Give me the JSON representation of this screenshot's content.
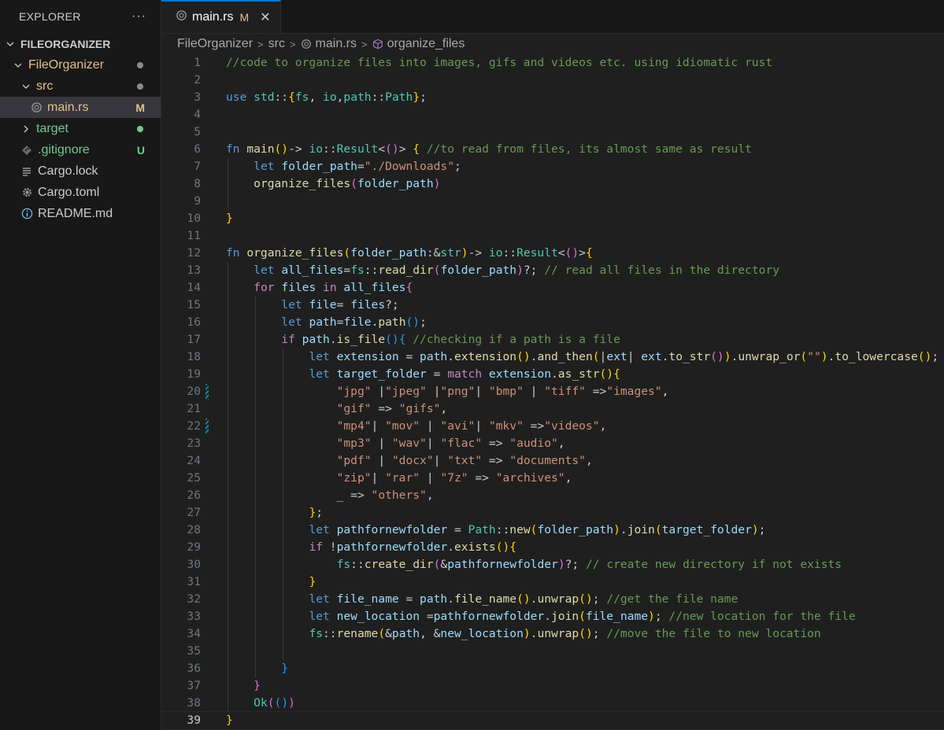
{
  "sidebar": {
    "title": "EXPLORER",
    "more": "···",
    "root": "FILEORGANIZER",
    "items": [
      {
        "label": "FileOrganizer",
        "status": "dot",
        "status_color": "#8b8b8b"
      },
      {
        "label": "src",
        "status": "dot",
        "status_color": "#8b8b8b"
      },
      {
        "label": "main.rs",
        "badge": "M"
      },
      {
        "label": "target",
        "status": "dot",
        "status_color": "#73c991"
      },
      {
        "label": ".gitignore",
        "badge": "U"
      },
      {
        "label": "Cargo.lock"
      },
      {
        "label": "Cargo.toml"
      },
      {
        "label": "README.md"
      }
    ]
  },
  "tab": {
    "label": "main.rs",
    "modified": "M",
    "close": "✕"
  },
  "breadcrumb": [
    "FileOrganizer",
    "src",
    "main.rs",
    "organize_files"
  ],
  "editor": {
    "active_line": 39,
    "lines": [
      [
        [
          "com",
          "//code to organize files into images, gifs and videos etc. using idiomatic rust"
        ]
      ],
      [],
      [
        [
          "kw",
          "use "
        ],
        [
          "ty",
          "std"
        ],
        [
          "",
          "::"
        ],
        [
          "p1",
          "{"
        ],
        [
          "ty",
          "fs"
        ],
        [
          "",
          ", "
        ],
        [
          "ty",
          "io"
        ],
        [
          "",
          ","
        ],
        [
          "ty",
          "path"
        ],
        [
          "",
          "::"
        ],
        [
          "ty",
          "Path"
        ],
        [
          "p1",
          "}"
        ],
        [
          "",
          ";"
        ]
      ],
      [],
      [],
      [
        [
          "kw",
          "fn "
        ],
        [
          "fn",
          "main"
        ],
        [
          "p1",
          "()"
        ],
        [
          "",
          "-> "
        ],
        [
          "ty",
          "io"
        ],
        [
          "",
          "::"
        ],
        [
          "ty",
          "Result"
        ],
        [
          "",
          "<"
        ],
        [
          "p2",
          "()"
        ],
        [
          "",
          "> "
        ],
        [
          "p1",
          "{"
        ],
        [
          "com",
          " //to read from files, its almost same as result"
        ]
      ],
      [
        [
          "",
          "    "
        ],
        [
          "kw",
          "let "
        ],
        [
          "var",
          "folder_path"
        ],
        [
          "",
          "="
        ],
        [
          "str",
          "\"./Downloads\""
        ],
        [
          "",
          ";"
        ]
      ],
      [
        [
          "",
          "    "
        ],
        [
          "fn",
          "organize_files"
        ],
        [
          "p2",
          "("
        ],
        [
          "var",
          "folder_path"
        ],
        [
          "p2",
          ")"
        ]
      ],
      [],
      [
        [
          "p1",
          "}"
        ]
      ],
      [],
      [
        [
          "kw",
          "fn "
        ],
        [
          "fn",
          "organize_files"
        ],
        [
          "p1",
          "("
        ],
        [
          "var",
          "folder_path"
        ],
        [
          "",
          ":&"
        ],
        [
          "ty",
          "str"
        ],
        [
          "p1",
          ")"
        ],
        [
          "",
          "-> "
        ],
        [
          "ty",
          "io"
        ],
        [
          "",
          "::"
        ],
        [
          "ty",
          "Result"
        ],
        [
          "",
          "<"
        ],
        [
          "p2",
          "()"
        ],
        [
          "",
          ">"
        ],
        [
          "p1",
          "{"
        ]
      ],
      [
        [
          "",
          "    "
        ],
        [
          "kw",
          "let "
        ],
        [
          "var",
          "all_files"
        ],
        [
          "",
          "="
        ],
        [
          "ty",
          "fs"
        ],
        [
          "",
          "::"
        ],
        [
          "fn",
          "read_dir"
        ],
        [
          "p2",
          "("
        ],
        [
          "var",
          "folder_path"
        ],
        [
          "p2",
          ")"
        ],
        [
          "",
          "?; "
        ],
        [
          "com",
          "// read all files in the directory"
        ]
      ],
      [
        [
          "",
          "    "
        ],
        [
          "ctrl",
          "for "
        ],
        [
          "var",
          "files "
        ],
        [
          "ctrl",
          "in "
        ],
        [
          "var",
          "all_files"
        ],
        [
          "p2",
          "{"
        ]
      ],
      [
        [
          "",
          "        "
        ],
        [
          "kw",
          "let "
        ],
        [
          "var",
          "file"
        ],
        [
          "",
          "= "
        ],
        [
          "var",
          "files"
        ],
        [
          "",
          "?;"
        ]
      ],
      [
        [
          "",
          "        "
        ],
        [
          "kw",
          "let "
        ],
        [
          "var",
          "path"
        ],
        [
          "",
          "="
        ],
        [
          "var",
          "file"
        ],
        [
          "",
          "."
        ],
        [
          "fn",
          "path"
        ],
        [
          "p3",
          "()"
        ],
        [
          "",
          ";"
        ]
      ],
      [
        [
          "",
          "        "
        ],
        [
          "ctrl",
          "if "
        ],
        [
          "var",
          "path"
        ],
        [
          "",
          "."
        ],
        [
          "fn",
          "is_file"
        ],
        [
          "p3",
          "()"
        ],
        [
          "p3",
          "{"
        ],
        [
          "com",
          " //checking if a path is a file"
        ]
      ],
      [
        [
          "",
          "            "
        ],
        [
          "kw",
          "let "
        ],
        [
          "var",
          "extension"
        ],
        [
          "",
          " = "
        ],
        [
          "var",
          "path"
        ],
        [
          "",
          "."
        ],
        [
          "fn",
          "extension"
        ],
        [
          "p1",
          "()"
        ],
        [
          "",
          "."
        ],
        [
          "fn",
          "and_then"
        ],
        [
          "p1",
          "("
        ],
        [
          "",
          "|"
        ],
        [
          "var",
          "ext"
        ],
        [
          "",
          "| "
        ],
        [
          "var",
          "ext"
        ],
        [
          "",
          "."
        ],
        [
          "fn",
          "to_str"
        ],
        [
          "p2",
          "()"
        ],
        [
          "p1",
          ")"
        ],
        [
          "",
          "."
        ],
        [
          "fn",
          "unwrap_or"
        ],
        [
          "p1",
          "("
        ],
        [
          "str",
          "\"\""
        ],
        [
          "p1",
          ")"
        ],
        [
          "",
          "."
        ],
        [
          "fn",
          "to_lowercase"
        ],
        [
          "p1",
          "()"
        ],
        [
          "",
          ";"
        ]
      ],
      [
        [
          "",
          "            "
        ],
        [
          "kw",
          "let "
        ],
        [
          "var",
          "target_folder"
        ],
        [
          "",
          " = "
        ],
        [
          "ctrl",
          "match "
        ],
        [
          "var",
          "extension"
        ],
        [
          "",
          "."
        ],
        [
          "fn",
          "as_str"
        ],
        [
          "p1",
          "()"
        ],
        [
          "p1",
          "{"
        ]
      ],
      [
        [
          "",
          "                "
        ],
        [
          "str",
          "\"jpg\""
        ],
        [
          "",
          " |"
        ],
        [
          "str",
          "\"jpeg\""
        ],
        [
          "",
          " |"
        ],
        [
          "str",
          "\"png\""
        ],
        [
          "",
          "| "
        ],
        [
          "str",
          "\"bmp\""
        ],
        [
          "",
          " | "
        ],
        [
          "str",
          "\"tiff\""
        ],
        [
          "",
          " =>"
        ],
        [
          "str",
          "\"images\""
        ],
        [
          "",
          ","
        ]
      ],
      [
        [
          "",
          "                "
        ],
        [
          "str",
          "\"gif\""
        ],
        [
          "",
          " => "
        ],
        [
          "str",
          "\"gifs\""
        ],
        [
          "",
          ","
        ]
      ],
      [
        [
          "",
          "                "
        ],
        [
          "str",
          "\"mp4\""
        ],
        [
          "",
          "| "
        ],
        [
          "str",
          "\"mov\""
        ],
        [
          "",
          " | "
        ],
        [
          "str",
          "\"avi\""
        ],
        [
          "",
          "| "
        ],
        [
          "str",
          "\"mkv\""
        ],
        [
          "",
          " =>"
        ],
        [
          "str",
          "\"videos\""
        ],
        [
          "",
          ","
        ]
      ],
      [
        [
          "",
          "                "
        ],
        [
          "str",
          "\"mp3\""
        ],
        [
          "",
          " | "
        ],
        [
          "str",
          "\"wav\""
        ],
        [
          "",
          "| "
        ],
        [
          "str",
          "\"flac\""
        ],
        [
          "",
          " => "
        ],
        [
          "str",
          "\"audio\""
        ],
        [
          "",
          ","
        ]
      ],
      [
        [
          "",
          "                "
        ],
        [
          "str",
          "\"pdf\""
        ],
        [
          "",
          " | "
        ],
        [
          "str",
          "\"docx\""
        ],
        [
          "",
          "| "
        ],
        [
          "str",
          "\"txt\""
        ],
        [
          "",
          " => "
        ],
        [
          "str",
          "\"documents\""
        ],
        [
          "",
          ","
        ]
      ],
      [
        [
          "",
          "                "
        ],
        [
          "str",
          "\"zip\""
        ],
        [
          "",
          "| "
        ],
        [
          "str",
          "\"rar\""
        ],
        [
          "",
          " | "
        ],
        [
          "str",
          "\"7z\""
        ],
        [
          "",
          " => "
        ],
        [
          "str",
          "\"archives\""
        ],
        [
          "",
          ","
        ]
      ],
      [
        [
          "",
          "                "
        ],
        [
          "var",
          "_"
        ],
        [
          "",
          " => "
        ],
        [
          "str",
          "\"others\""
        ],
        [
          "",
          ","
        ]
      ],
      [
        [
          "",
          "            "
        ],
        [
          "p1",
          "}"
        ],
        [
          "",
          ";"
        ]
      ],
      [
        [
          "",
          "            "
        ],
        [
          "kw",
          "let "
        ],
        [
          "var",
          "pathfornewfolder"
        ],
        [
          "",
          " = "
        ],
        [
          "ty",
          "Path"
        ],
        [
          "",
          "::"
        ],
        [
          "fn",
          "new"
        ],
        [
          "p1",
          "("
        ],
        [
          "var",
          "folder_path"
        ],
        [
          "p1",
          ")"
        ],
        [
          "",
          "."
        ],
        [
          "fn",
          "join"
        ],
        [
          "p1",
          "("
        ],
        [
          "var",
          "target_folder"
        ],
        [
          "p1",
          ")"
        ],
        [
          "",
          ";"
        ]
      ],
      [
        [
          "",
          "            "
        ],
        [
          "ctrl",
          "if "
        ],
        [
          "",
          "!"
        ],
        [
          "var",
          "pathfornewfolder"
        ],
        [
          "",
          "."
        ],
        [
          "fn",
          "exists"
        ],
        [
          "p1",
          "()"
        ],
        [
          "p1",
          "{"
        ]
      ],
      [
        [
          "",
          "                "
        ],
        [
          "ty",
          "fs"
        ],
        [
          "",
          "::"
        ],
        [
          "fn",
          "create_dir"
        ],
        [
          "p2",
          "("
        ],
        [
          "",
          "&"
        ],
        [
          "var",
          "pathfornewfolder"
        ],
        [
          "p2",
          ")"
        ],
        [
          "",
          "?; "
        ],
        [
          "com",
          "// create new directory if not exists"
        ]
      ],
      [
        [
          "",
          "            "
        ],
        [
          "p1",
          "}"
        ]
      ],
      [
        [
          "",
          "            "
        ],
        [
          "kw",
          "let "
        ],
        [
          "var",
          "file_name"
        ],
        [
          "",
          " = "
        ],
        [
          "var",
          "path"
        ],
        [
          "",
          "."
        ],
        [
          "fn",
          "file_name"
        ],
        [
          "p1",
          "()"
        ],
        [
          "",
          "."
        ],
        [
          "fn",
          "unwrap"
        ],
        [
          "p1",
          "()"
        ],
        [
          "",
          "; "
        ],
        [
          "com",
          "//get the file name"
        ]
      ],
      [
        [
          "",
          "            "
        ],
        [
          "kw",
          "let "
        ],
        [
          "var",
          "new_location"
        ],
        [
          "",
          " ="
        ],
        [
          "var",
          "pathfornewfolder"
        ],
        [
          "",
          "."
        ],
        [
          "fn",
          "join"
        ],
        [
          "p1",
          "("
        ],
        [
          "var",
          "file_name"
        ],
        [
          "p1",
          ")"
        ],
        [
          "",
          "; "
        ],
        [
          "com",
          "//new location for the file"
        ]
      ],
      [
        [
          "",
          "            "
        ],
        [
          "ty",
          "fs"
        ],
        [
          "",
          "::"
        ],
        [
          "fn",
          "rename"
        ],
        [
          "p1",
          "("
        ],
        [
          "",
          "&"
        ],
        [
          "var",
          "path"
        ],
        [
          "",
          ", &"
        ],
        [
          "var",
          "new_location"
        ],
        [
          "p1",
          ")"
        ],
        [
          "",
          "."
        ],
        [
          "fn",
          "unwrap"
        ],
        [
          "p1",
          "()"
        ],
        [
          "",
          "; "
        ],
        [
          "com",
          "//move the file to new location"
        ]
      ],
      [],
      [
        [
          "",
          "        "
        ],
        [
          "p3",
          "}"
        ]
      ],
      [
        [
          "",
          "    "
        ],
        [
          "p2",
          "}"
        ]
      ],
      [
        [
          "",
          "    "
        ],
        [
          "ty",
          "Ok"
        ],
        [
          "p2",
          "("
        ],
        [
          "p3",
          "()"
        ],
        [
          "p2",
          ")"
        ]
      ],
      [
        [
          "p1",
          "}"
        ]
      ]
    ]
  }
}
